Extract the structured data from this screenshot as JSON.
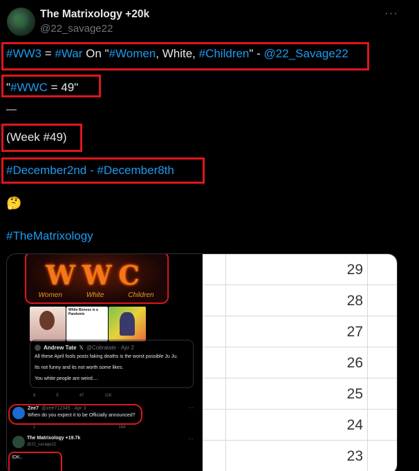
{
  "post": {
    "display_name": "The Matrixology +20k",
    "handle": "@22_savage22",
    "more_icon": "more-icon",
    "lines": {
      "l1": {
        "p1": "#WW3",
        "p2": " = ",
        "p3": "#War",
        "p4": " On \"",
        "p5": "#Women",
        "p6": ", White, ",
        "p7": "#Children",
        "p8": "\" - ",
        "p9": "@22_Savage22"
      },
      "l2": {
        "p1": "\"",
        "p2": "#WWC",
        "p3": " = 49\""
      },
      "l3": "—",
      "l4": "(Week #49)",
      "l5": {
        "p1": "#December2nd",
        "p2": " - ",
        "p3": "#December8th"
      },
      "l6": "🤔",
      "l7": "#TheMatrixology"
    },
    "colors": {
      "link": "#1d9bf0",
      "highlight_box": "#e0161e",
      "background": "#000000"
    }
  },
  "media_left": {
    "banner": {
      "letters": "WWC",
      "words": [
        "Women",
        "White",
        "Children"
      ]
    },
    "thumb_caption": "White Boness is a Pandemic",
    "quoted": {
      "name": "Andrew Tate",
      "badge": "𝕏",
      "handle_date": "@Cobratate · Apr 2",
      "text1": "All these April fools posts faking deaths is the worst possible Ju Ju.",
      "text2": "Its not funny and its not worth some likes.",
      "text3": "You white people are weird...."
    },
    "actions1": {
      "replies": "8",
      "retweets": "5",
      "likes": "47",
      "views": "11K"
    },
    "reply1": {
      "name": "Zee7",
      "handle_date": "@zee712345 · Apr 3",
      "text": "When do you expect it to be Officially announced?"
    },
    "actions2": {
      "replies": "1",
      "views": "184"
    },
    "reply2": {
      "name": "The Matrixology +19.7k",
      "handle": "@22_savage22",
      "text": "IDK.."
    }
  },
  "media_right": {
    "rows": [
      "29",
      "28",
      "27",
      "26",
      "25",
      "24",
      "23"
    ]
  }
}
